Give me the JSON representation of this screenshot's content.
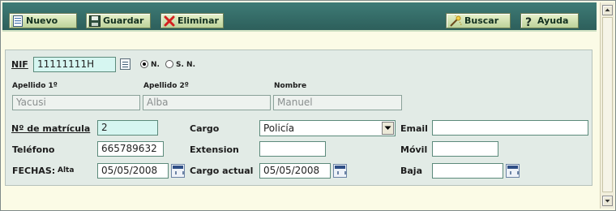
{
  "toolbar": {
    "nuevo": "Nuevo",
    "guardar": "Guardar",
    "eliminar": "Eliminar",
    "buscar": "Buscar",
    "ayuda": "Ayuda"
  },
  "form": {
    "nif_label": "NIF",
    "nif_value": "11111111H",
    "radio_n": "N.",
    "radio_sn": "S. N.",
    "radio_selected": "N.",
    "apellido1_label": "Apellido 1º",
    "apellido1_value": "Yacusi",
    "apellido2_label": "Apellido 2º",
    "apellido2_value": "Alba",
    "nombre_label": "Nombre",
    "nombre_value": "Manuel",
    "matricula_label": "Nº de matrícula",
    "matricula_value": "2",
    "cargo_label": "Cargo",
    "cargo_value": "Policía",
    "email_label": "Email",
    "email_value": "",
    "telefono_label": "Teléfono",
    "telefono_value": "665789632",
    "extension_label": "Extension",
    "extension_value": "",
    "movil_label": "Móvil",
    "movil_value": "",
    "fechas_label": "FECHAS:",
    "alta_label": "Alta",
    "alta_value": "05/05/2008",
    "cargo_actual_label": "Cargo actual",
    "cargo_actual_value": "05/05/2008",
    "baja_label": "Baja",
    "baja_value": ""
  },
  "colors": {
    "toolbar_bg": "#3e7b76",
    "button_bg": "#d4e6b5",
    "panel_bg": "#e2ebe6",
    "highlight_input": "#d6f6f1",
    "page_bg": "#fbfbe6"
  }
}
